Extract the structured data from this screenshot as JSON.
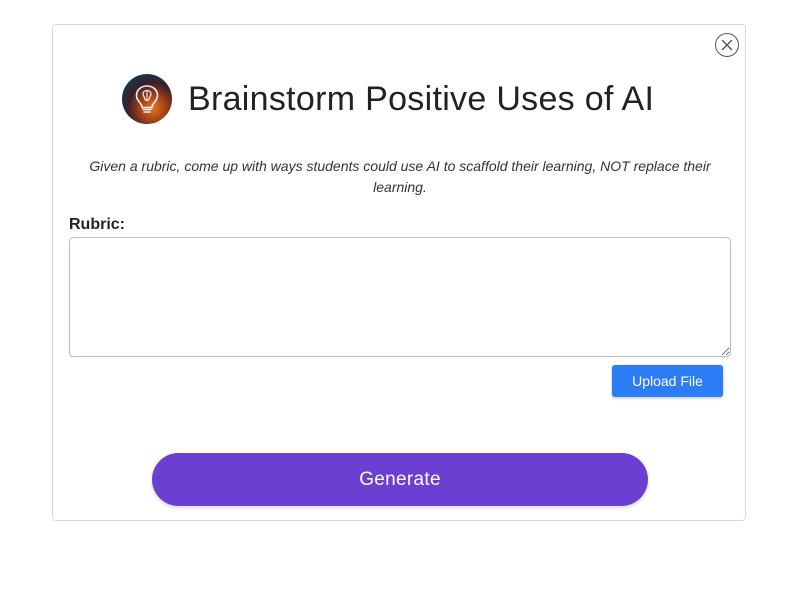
{
  "header": {
    "title": "Brainstorm Positive Uses of AI",
    "logo_icon": "lightbulb-brain-icon"
  },
  "description": "Given a rubric, come up with ways students could use AI to scaffold their learning, NOT replace their learning.",
  "rubric": {
    "label": "Rubric:",
    "value": "",
    "placeholder": ""
  },
  "actions": {
    "upload_label": "Upload File",
    "generate_label": "Generate",
    "close_icon": "close-icon"
  },
  "colors": {
    "upload_button": "#2b7cf5",
    "generate_button": "#6a3fd1"
  }
}
